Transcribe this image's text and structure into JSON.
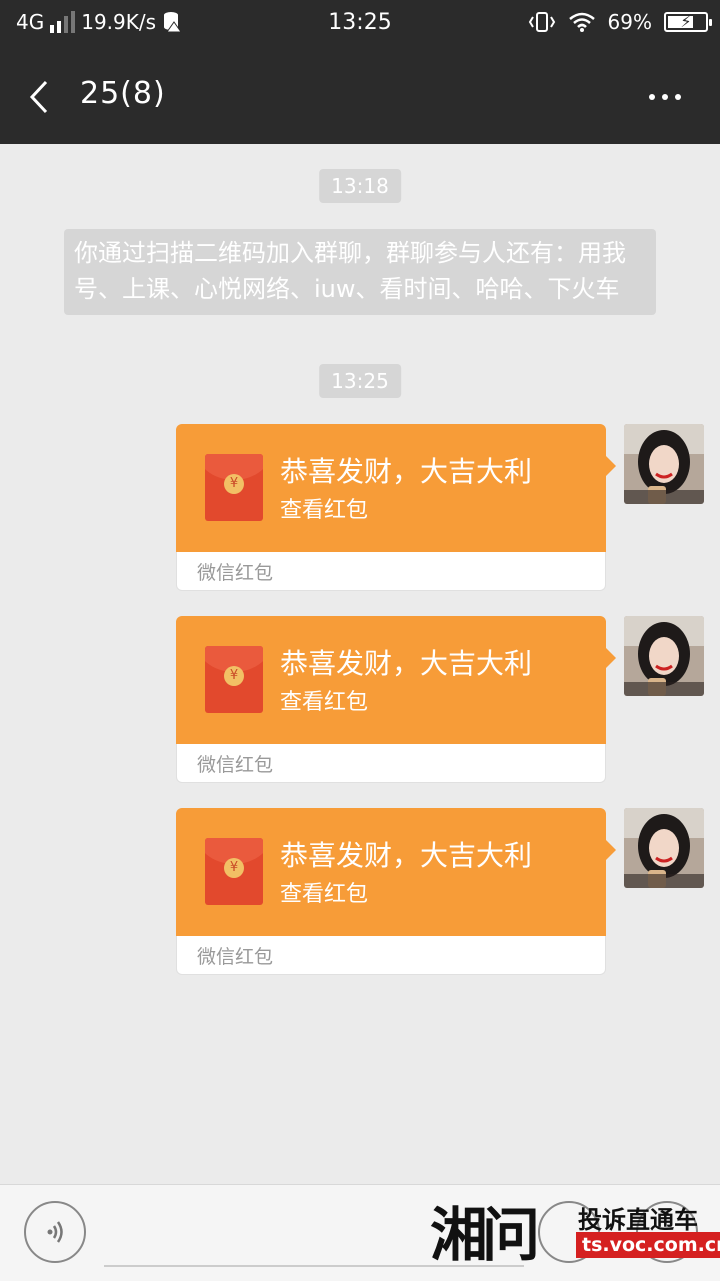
{
  "status_bar": {
    "network": "4G",
    "speed": "19.9K/s",
    "time": "13:25",
    "battery_percent": "69%",
    "battery_level": 0.69
  },
  "header": {
    "title": "25(8)"
  },
  "messages": {
    "time1": "13:18",
    "system_text": "你通过扫描二维码加入群聊，群聊参与人还有：用我号、上课、心悦网络、iuw、看时间、哈哈、下火车",
    "time2": "13:25",
    "red_packets": [
      {
        "title": "恭喜发财，大吉大利",
        "subtitle": "查看红包",
        "source": "微信红包"
      },
      {
        "title": "恭喜发财，大吉大利",
        "subtitle": "查看红包",
        "source": "微信红包"
      },
      {
        "title": "恭喜发财，大吉大利",
        "subtitle": "查看红包",
        "source": "微信红包"
      }
    ],
    "currency_symbol": "¥"
  },
  "watermark": {
    "logo_text": "湘问",
    "title": "投诉直通车",
    "url": "ts.voc.com.cn"
  },
  "colors": {
    "topbar": "#2b2b2b",
    "background": "#ebebeb",
    "red_packet": "#f79c38",
    "envelope": "#e2492d",
    "watermark_red": "#d52020"
  }
}
